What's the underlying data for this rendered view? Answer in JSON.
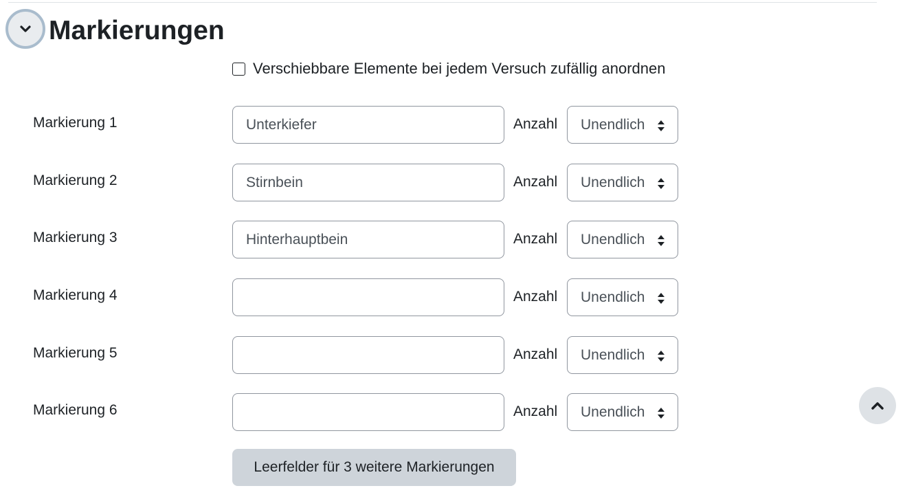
{
  "section": {
    "title": "Markierungen",
    "collapse_icon": "chevron-down-icon"
  },
  "shuffle": {
    "label": "Verschiebbare Elemente bei jedem Versuch zufällig anordnen",
    "checked": false
  },
  "markers": [
    {
      "label": "Markierung 1",
      "value": "Unterkiefer",
      "count_label": "Anzahl",
      "count_value": "Unendlich"
    },
    {
      "label": "Markierung 2",
      "value": "Stirnbein",
      "count_label": "Anzahl",
      "count_value": "Unendlich"
    },
    {
      "label": "Markierung 3",
      "value": "Hinterhauptbein",
      "count_label": "Anzahl",
      "count_value": "Unendlich"
    },
    {
      "label": "Markierung 4",
      "value": "",
      "count_label": "Anzahl",
      "count_value": "Unendlich"
    },
    {
      "label": "Markierung 5",
      "value": "",
      "count_label": "Anzahl",
      "count_value": "Unendlich"
    },
    {
      "label": "Markierung 6",
      "value": "",
      "count_label": "Anzahl",
      "count_value": "Unendlich"
    }
  ],
  "add_button": {
    "label": "Leerfelder für 3 weitere Markierungen"
  },
  "scroll_top": {
    "icon": "chevron-up-icon"
  },
  "colors": {
    "text": "#1d2125",
    "input_border": "#8f959e",
    "button_bg": "#ced4da",
    "collapse_ring": "#a9bccd"
  }
}
